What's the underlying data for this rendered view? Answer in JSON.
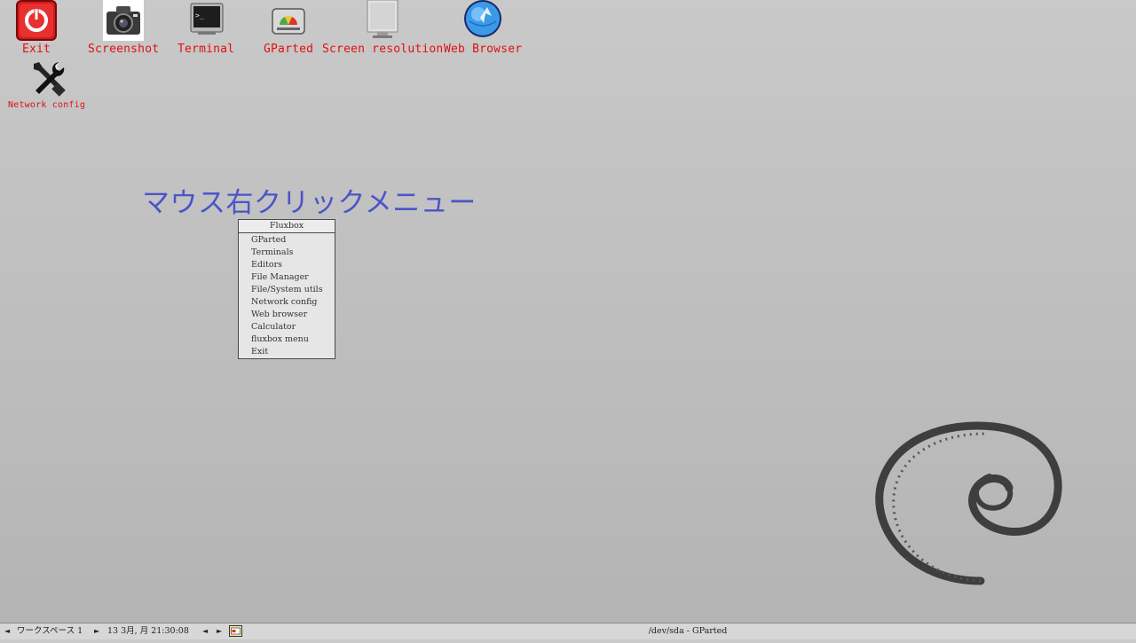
{
  "desktop_icons": [
    {
      "label": "Exit",
      "icon": "power-icon"
    },
    {
      "label": "Screenshot",
      "icon": "camera-icon"
    },
    {
      "label": "Terminal",
      "icon": "terminal-icon"
    },
    {
      "label": "GParted",
      "icon": "gparted-disk-icon"
    },
    {
      "label": "Screen resolution",
      "icon": "monitor-icon"
    },
    {
      "label": "Web Browser",
      "icon": "globe-icon"
    },
    {
      "label": "Network config",
      "icon": "wrench-screwdriver-icon"
    }
  ],
  "annotation": "マウス右クリックメニュー",
  "menu": {
    "title": "Fluxbox",
    "items": [
      "GParted",
      "Terminals",
      "Editors",
      "File Manager",
      "File/System utils",
      "Network config",
      "Web browser",
      "Calculator",
      "fluxbox menu",
      "Exit"
    ]
  },
  "taskbar": {
    "prev_workspace": "◄",
    "workspace": "ワークスペース 1",
    "next_workspace": "►",
    "clock": "13 3月, 月 21:30:08",
    "prev_window": "◄",
    "next_window": "►",
    "task_title": "/dev/sda - GParted"
  },
  "colors": {
    "icon_label": "#e01010",
    "annotation": "#4b55c8",
    "background": "#c2c2c2"
  }
}
